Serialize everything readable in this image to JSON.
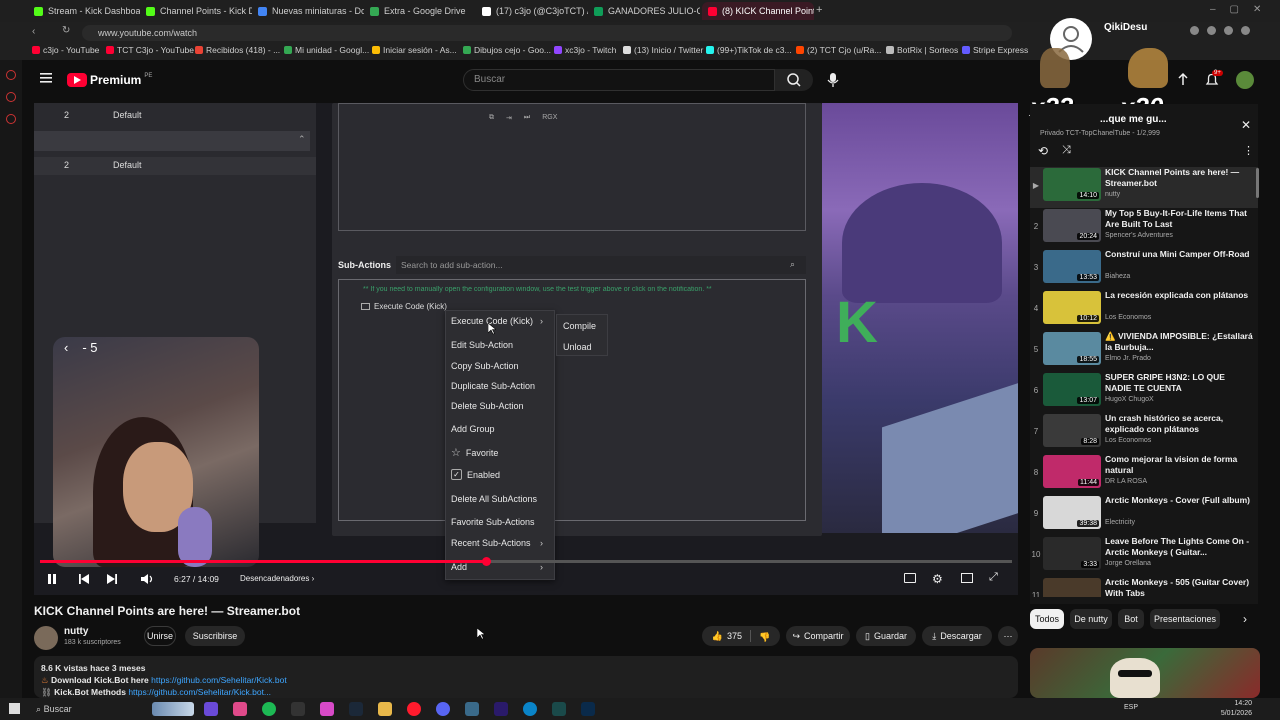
{
  "browser": {
    "tabs": [
      {
        "label": "Stream - Kick Dashboard",
        "color": "#53fc18"
      },
      {
        "label": "Channel Points - Kick Das",
        "color": "#53fc18"
      },
      {
        "label": "Nuevas miniaturas - Docu",
        "color": "#4285f4"
      },
      {
        "label": "Extra - Google Drive",
        "color": "#34a853"
      },
      {
        "label": "(17) c3jo (@C3joTCT) / X",
        "color": "#ffffff"
      },
      {
        "label": "GANADORES JULIO-OCT",
        "color": "#0f9d58"
      },
      {
        "label": "(8) KICK Channel Point",
        "color": "#ff0033",
        "active": true
      }
    ],
    "url": "www.youtube.com/watch",
    "bookmarks": [
      "c3jo - YouTube",
      "TCT C3jo - YouTube",
      "Recibidos (418) - ...",
      "Mi unidad - Googl...",
      "Iniciar sesión - As...",
      "Dibujos cejo - Goo...",
      "xc3jo - Twitch",
      "(13) Inicio / Twitter",
      "(99+)TikTok de c3...",
      "(2) TCT Cjo (u/Ra...",
      "BotRix | Sorteos",
      "Stripe Express"
    ]
  },
  "youtube": {
    "logo_text": "Premium",
    "logo_sup": "PE",
    "search_placeholder": "Buscar",
    "notif_count": "9+"
  },
  "overlay": {
    "user_name": "QikiDesu",
    "counter_left": "x23",
    "counter_right": "x20"
  },
  "video": {
    "streamerbot": {
      "rows": [
        {
          "num": "2",
          "label": "Default"
        },
        {
          "num": "2",
          "label": "Default"
        }
      ],
      "subactions_label": "Sub-Actions",
      "search_placeholder": "Search to add sub-action...",
      "comment": "** If you need to manually open the configuration window, use the test trigger above or click on the notification. **",
      "item": "Execute Code (Kick)",
      "toolbar_text": "RGX"
    },
    "context_menu": [
      {
        "label": "Execute Code (Kick)",
        "arrow": true
      },
      {
        "label": "Edit Sub-Action"
      },
      {
        "label": "Copy Sub-Action"
      },
      {
        "label": "Duplicate Sub-Action"
      },
      {
        "label": "Delete Sub-Action"
      },
      {
        "label": "Add Group"
      },
      {
        "label": "Favorite",
        "icon": "star-icon"
      },
      {
        "label": "Enabled",
        "icon": "checkbox-icon"
      },
      {
        "label": "Delete All SubActions"
      },
      {
        "label": "Favorite Sub-Actions"
      },
      {
        "label": "Recent Sub-Actions",
        "arrow": true
      },
      {
        "label": "Add",
        "arrow": true
      }
    ],
    "submenu": [
      "Compile",
      "Unload"
    ],
    "seek_indicator": "- 5",
    "time": "6:27 / 14:09",
    "progress": 0.458,
    "chapter": "Desencadenadores"
  },
  "below": {
    "title": "KICK Channel Points are here! — Streamer.bot",
    "channel": "nutty",
    "subscribers": "183 k suscriptores",
    "join": "Unirse",
    "subscribe": "Suscribirse",
    "likes": "375",
    "share": "Compartir",
    "save": "Guardar",
    "download": "Descargar",
    "desc_stats": "8.6 K vistas  hace 3 meses",
    "desc_line1_label": "Download Kick.Bot here",
    "desc_line1_link": "https://github.com/Sehelitar/Kick.bot",
    "desc_line2_label": "Kick.Bot Methods",
    "desc_line2_link": "https://github.com/Sehelitar/Kick.bot..."
  },
  "playlist": {
    "title": "...que me gu...",
    "meta": "Privado  TCT-TopChanelTube - 1/2,999",
    "items": [
      {
        "num": "▶",
        "title": "KICK Channel Points are here! — Streamer.bot",
        "channel": "nutty",
        "duration": "14:10",
        "thumb": "#2b6a3a"
      },
      {
        "num": "2",
        "title": "My Top 5 Buy-It-For-Life Items That Are Built To Last",
        "channel": "Spencer's Adventures",
        "duration": "20:24",
        "thumb": "#4a4a52"
      },
      {
        "num": "3",
        "title": "Construí una Mini Camper Off-Road",
        "channel": "Biaheza",
        "duration": "13:53",
        "thumb": "#3a6a8a"
      },
      {
        "num": "4",
        "title": "La recesión explicada con plátanos",
        "channel": "Los Economos",
        "duration": "10:12",
        "thumb": "#d8c23a"
      },
      {
        "num": "5",
        "title": "⚠️ VIVIENDA IMPOSIBLE: ¿Estallará la Burbuja...",
        "channel": "Elmo Jr. Prado",
        "duration": "18:55",
        "thumb": "#5a8aa0"
      },
      {
        "num": "6",
        "title": "SUPER GRIPE H3N2: LO QUE NADIE TE CUENTA",
        "channel": "HugoX ChugoX",
        "duration": "13:07",
        "thumb": "#1a5a3a"
      },
      {
        "num": "7",
        "title": "Un crash histórico se acerca, explicado con plátanos",
        "channel": "Los Economos",
        "duration": "8:28",
        "thumb": "#3a3a3a"
      },
      {
        "num": "8",
        "title": "Como mejorar la vision de forma natural",
        "channel": "DR LA ROSA",
        "duration": "11:44",
        "thumb": "#c02a6a"
      },
      {
        "num": "9",
        "title": "Arctic Monkeys - Cover (Full album)",
        "channel": "Electricity",
        "duration": "39:38",
        "thumb": "#d8d8d8"
      },
      {
        "num": "10",
        "title": "Leave Before The Lights Come On - Arctic Monkeys ( Guitar...",
        "channel": "Jorge Orellana",
        "duration": "3:33",
        "thumb": "#2a2a2a"
      },
      {
        "num": "11",
        "title": "Arctic Monkeys - 505 (Guitar Cover) With Tabs",
        "channel": "",
        "duration": "",
        "thumb": "#4a3a2a"
      }
    ]
  },
  "chips": [
    "Todos",
    "De nutty",
    "Bot",
    "Presentaciones"
  ],
  "taskbar": {
    "search": "Buscar",
    "lang": "ESP",
    "time": "14:20",
    "date": "5/01/2026"
  }
}
